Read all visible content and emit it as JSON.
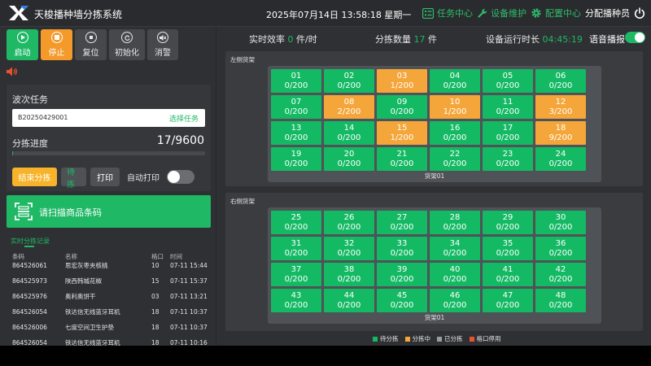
{
  "header": {
    "title": "天梭播种墙分拣系统",
    "datetime": "2025年07月14日 13:58:18 星期一",
    "nav": [
      "任务中心",
      "设备维护",
      "配置中心"
    ],
    "user": "分配播种员"
  },
  "toolbar": {
    "buttons": [
      "启动",
      "停止",
      "复位",
      "初始化",
      "消警"
    ]
  },
  "wave": {
    "title": "波次任务",
    "task_id": "B20250429001",
    "select_task": "选择任务",
    "progress_label": "分拣进度",
    "progress_text": "17/9600",
    "progress_fraction": 0.0018
  },
  "actions": {
    "end_sort": "结束分拣",
    "wait_sort": "待拣",
    "print": "打印",
    "auto_print": "自动打印",
    "auto_print_on": false
  },
  "scan": {
    "prompt": "请扫描商品条码"
  },
  "records": {
    "title": "实时分拣记录",
    "headers": [
      "条码",
      "名称",
      "格口",
      "时间"
    ],
    "rows": [
      [
        "864526061",
        "思宏灰枣夹核桃",
        "10",
        "07-11 15:44"
      ],
      [
        "864525973",
        "陕西韩城花椒",
        "15",
        "07-11 15:37"
      ],
      [
        "864525976",
        "奥利奥饼干",
        "03",
        "07-11 13:21"
      ],
      [
        "864526054",
        "铁达信无线蓝牙耳机",
        "18",
        "07-11 10:37"
      ],
      [
        "864526006",
        "七度空间卫生护垫",
        "18",
        "07-11 10:37"
      ],
      [
        "864526054",
        "铁达信无线蓝牙耳机",
        "18",
        "07-11 10:16"
      ]
    ]
  },
  "stats": {
    "efficiency_label": "实时效率",
    "efficiency_value": "0",
    "efficiency_unit": "件/时",
    "sorted_label": "分拣数量",
    "sorted_value": "17",
    "sorted_unit": "件",
    "uptime_label": "设备运行时长",
    "uptime_value": "04:45:19",
    "voice_label": "语音播报",
    "voice_on": true
  },
  "shelves": [
    {
      "label": "左侧货架",
      "name": "货架01",
      "cells": [
        {
          "no": "01",
          "count": "0/200",
          "state": "green"
        },
        {
          "no": "02",
          "count": "0/200",
          "state": "green"
        },
        {
          "no": "03",
          "count": "1/200",
          "state": "orange"
        },
        {
          "no": "04",
          "count": "0/200",
          "state": "green"
        },
        {
          "no": "05",
          "count": "0/200",
          "state": "green"
        },
        {
          "no": "06",
          "count": "0/200",
          "state": "green"
        },
        {
          "no": "07",
          "count": "0/200",
          "state": "green"
        },
        {
          "no": "08",
          "count": "2/200",
          "state": "orange"
        },
        {
          "no": "09",
          "count": "0/200",
          "state": "green"
        },
        {
          "no": "10",
          "count": "1/200",
          "state": "orange"
        },
        {
          "no": "11",
          "count": "0/200",
          "state": "green"
        },
        {
          "no": "12",
          "count": "3/200",
          "state": "orange"
        },
        {
          "no": "13",
          "count": "0/200",
          "state": "green"
        },
        {
          "no": "14",
          "count": "0/200",
          "state": "green"
        },
        {
          "no": "15",
          "count": "1/200",
          "state": "orange"
        },
        {
          "no": "16",
          "count": "0/200",
          "state": "green"
        },
        {
          "no": "17",
          "count": "0/200",
          "state": "green"
        },
        {
          "no": "18",
          "count": "9/200",
          "state": "orange"
        },
        {
          "no": "19",
          "count": "0/200",
          "state": "green"
        },
        {
          "no": "20",
          "count": "0/200",
          "state": "green"
        },
        {
          "no": "21",
          "count": "0/200",
          "state": "green"
        },
        {
          "no": "22",
          "count": "0/200",
          "state": "green"
        },
        {
          "no": "23",
          "count": "0/200",
          "state": "green"
        },
        {
          "no": "24",
          "count": "0/200",
          "state": "green"
        }
      ]
    },
    {
      "label": "右侧货架",
      "name": "货架01",
      "cells": [
        {
          "no": "25",
          "count": "0/200",
          "state": "green"
        },
        {
          "no": "26",
          "count": "0/200",
          "state": "green"
        },
        {
          "no": "27",
          "count": "0/200",
          "state": "green"
        },
        {
          "no": "28",
          "count": "0/200",
          "state": "green"
        },
        {
          "no": "29",
          "count": "0/200",
          "state": "green"
        },
        {
          "no": "30",
          "count": "0/200",
          "state": "green"
        },
        {
          "no": "31",
          "count": "0/200",
          "state": "green"
        },
        {
          "no": "32",
          "count": "0/200",
          "state": "green"
        },
        {
          "no": "33",
          "count": "0/200",
          "state": "green"
        },
        {
          "no": "34",
          "count": "0/200",
          "state": "green"
        },
        {
          "no": "35",
          "count": "0/200",
          "state": "green"
        },
        {
          "no": "36",
          "count": "0/200",
          "state": "green"
        },
        {
          "no": "37",
          "count": "0/200",
          "state": "green"
        },
        {
          "no": "38",
          "count": "0/200",
          "state": "green"
        },
        {
          "no": "39",
          "count": "0/200",
          "state": "green"
        },
        {
          "no": "40",
          "count": "0/200",
          "state": "green"
        },
        {
          "no": "41",
          "count": "0/200",
          "state": "green"
        },
        {
          "no": "42",
          "count": "0/200",
          "state": "green"
        },
        {
          "no": "43",
          "count": "0/200",
          "state": "green"
        },
        {
          "no": "44",
          "count": "0/200",
          "state": "green"
        },
        {
          "no": "45",
          "count": "0/200",
          "state": "green"
        },
        {
          "no": "46",
          "count": "0/200",
          "state": "green"
        },
        {
          "no": "47",
          "count": "0/200",
          "state": "green"
        },
        {
          "no": "48",
          "count": "0/200",
          "state": "green"
        }
      ]
    }
  ],
  "legend": [
    {
      "label": "待分拣",
      "color": "#14b964"
    },
    {
      "label": "分拣中",
      "color": "#f5a63a"
    },
    {
      "label": "已分拣",
      "color": "#9a9c9f"
    },
    {
      "label": "格口停用",
      "color": "#e8542f"
    }
  ],
  "colors": {
    "accent_green": "#1fb865",
    "accent_orange": "#f39a2b"
  }
}
